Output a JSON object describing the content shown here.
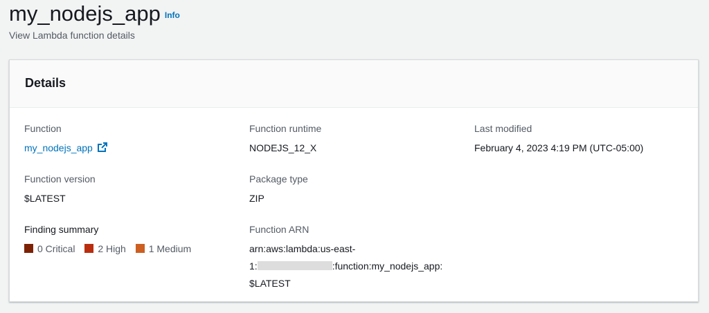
{
  "header": {
    "title": "my_nodejs_app",
    "info": "Info",
    "subtitle": "View Lambda function details"
  },
  "details": {
    "heading": "Details",
    "function_label": "Function",
    "function_value": "my_nodejs_app",
    "version_label": "Function version",
    "version_value": "$LATEST",
    "finding_label": "Finding summary",
    "findings": [
      {
        "label": "0 Critical",
        "color": "#7d2105"
      },
      {
        "label": "2 High",
        "color": "#ba2e0f"
      },
      {
        "label": "1 Medium",
        "color": "#cc5f21"
      }
    ],
    "runtime_label": "Function runtime",
    "runtime_value": "NODEJS_12_X",
    "package_label": "Package type",
    "package_value": "ZIP",
    "arn_label": "Function ARN",
    "arn_line1": "arn:aws:lambda:us-east-",
    "arn_line2_prefix": "1:",
    "arn_line2_suffix": ":function:my_nodejs_app:",
    "arn_line3": "$LATEST",
    "modified_label": "Last modified",
    "modified_value": "February 4, 2023 4:19 PM (UTC-05:00)"
  }
}
